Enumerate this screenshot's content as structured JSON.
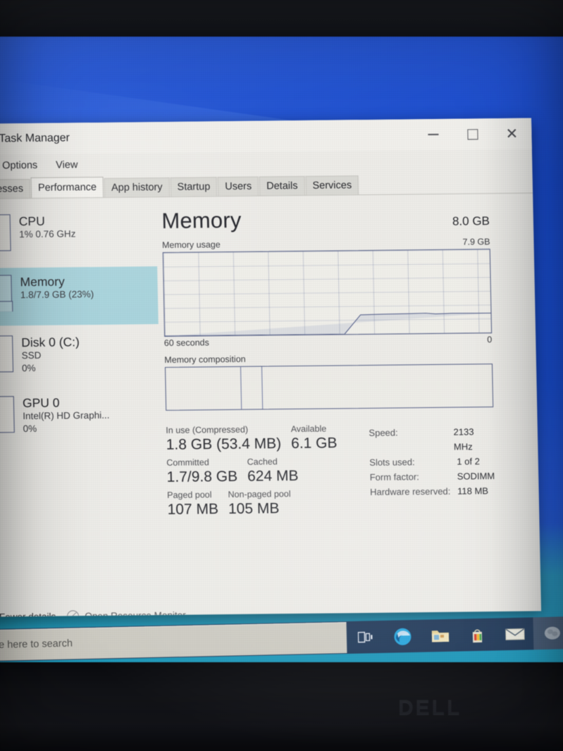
{
  "window": {
    "title": "Task Manager",
    "menu": [
      "Options",
      "View"
    ],
    "controls": {
      "minimize": "minimize-button",
      "maximize": "maximize-button",
      "close": "close-button"
    }
  },
  "tabs": [
    {
      "label": "cesses",
      "selected": false
    },
    {
      "label": "Performance",
      "selected": true
    },
    {
      "label": "App history",
      "selected": false
    },
    {
      "label": "Startup",
      "selected": false
    },
    {
      "label": "Users",
      "selected": false
    },
    {
      "label": "Details",
      "selected": false
    },
    {
      "label": "Services",
      "selected": false
    }
  ],
  "sidebar": {
    "items": [
      {
        "name": "CPU",
        "sub1": "1%  0.76 GHz",
        "sub2": "",
        "selected": false
      },
      {
        "name": "Memory",
        "sub1": "1.8/7.9 GB (23%)",
        "sub2": "",
        "selected": true
      },
      {
        "name": "Disk 0 (C:)",
        "sub1": "SSD",
        "sub2": "0%",
        "selected": false
      },
      {
        "name": "GPU 0",
        "sub1": "Intel(R) HD Graphi...",
        "sub2": "0%",
        "selected": false
      }
    ]
  },
  "main": {
    "title": "Memory",
    "total": "8.0 GB",
    "graph_label": "Memory usage",
    "graph_max": "7.9 GB",
    "graph_time_left": "60 seconds",
    "graph_time_right": "0",
    "composition_label": "Memory composition",
    "stats_left": [
      {
        "label": "In use (Compressed)",
        "value": "1.8 GB (53.4 MB)"
      },
      {
        "label": "Available",
        "value": "6.1 GB"
      },
      {
        "label": "Committed",
        "value": "1.7/9.8 GB"
      },
      {
        "label": "Cached",
        "value": "624 MB"
      },
      {
        "label": "Paged pool",
        "value": "107 MB"
      },
      {
        "label": "Non-paged pool",
        "value": "105 MB"
      }
    ],
    "stats_right": [
      {
        "key": "Speed:",
        "value": "2133 MHz"
      },
      {
        "key": "Slots used:",
        "value": "1 of 2"
      },
      {
        "key": "Form factor:",
        "value": "SODIMM"
      },
      {
        "key": "Hardware reserved:",
        "value": "118 MB"
      }
    ]
  },
  "footer": {
    "fewer_details": "Fewer details",
    "open_resource_monitor": "Open Resource Monitor"
  },
  "taskbar": {
    "search_placeholder": "pe here to search",
    "icons": [
      "task-view-icon",
      "edge-icon",
      "file-explorer-icon",
      "microsoft-store-icon",
      "mail-icon",
      "app-icon"
    ]
  },
  "laptop": {
    "brand": "DELL"
  },
  "chart_data": {
    "type": "line",
    "title": "Memory usage",
    "xlabel": "60 seconds",
    "ylabel": "Memory usage",
    "ylim": [
      0,
      7.9
    ],
    "xlim": [
      60,
      0
    ],
    "grid": true,
    "x": [
      60,
      50,
      40,
      30,
      28,
      26,
      24,
      22,
      20,
      16,
      12,
      10,
      8,
      6,
      4,
      2,
      0
    ],
    "y": [
      0,
      0,
      0,
      0,
      0,
      0,
      1.82,
      1.84,
      1.84,
      1.85,
      1.86,
      1.88,
      1.86,
      1.85,
      1.85,
      1.84,
      1.84
    ],
    "annotations": [
      "0",
      "60 seconds",
      "7.9 GB"
    ]
  }
}
